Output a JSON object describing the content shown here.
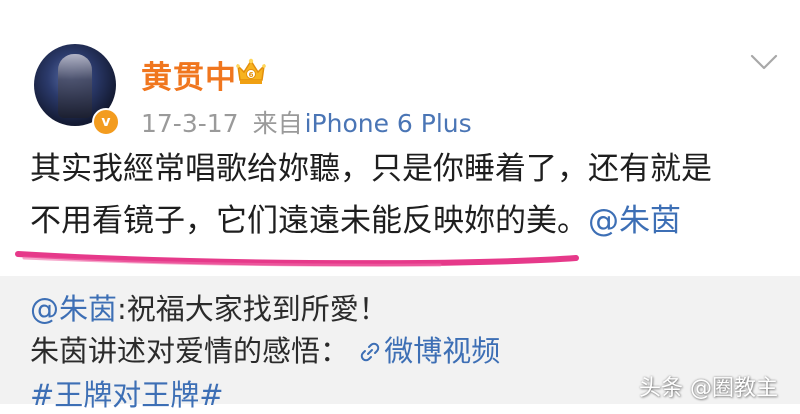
{
  "post": {
    "author": {
      "name": "黄贯中",
      "verified_badge": "v",
      "name_color": "#f0761e"
    },
    "meta": {
      "time": "17-3-17",
      "source_prefix": "来自",
      "source_device": "iPhone 6 Plus"
    },
    "text": {
      "line1": "其实我經常唱歌给妳聽，只是你睡着了，还有就是",
      "line2": "不用看镜子，它们遠遠未能反映妳的美。",
      "mention": "@朱茵"
    },
    "annotation_color": "#e6398a"
  },
  "repost": {
    "mention": "@朱茵",
    "line1_text": ":祝福大家找到所愛！",
    "line2_text": "朱茵讲述对爱情的感悟：",
    "video_link": "微博视频",
    "hashtag": "#王牌对王牌#",
    "link_color": "#3d6fb5"
  },
  "watermark": "头条 @圈教主",
  "icons": {
    "crown": "crown-icon",
    "chevron": "chevron-down-icon",
    "link": "link-icon"
  }
}
